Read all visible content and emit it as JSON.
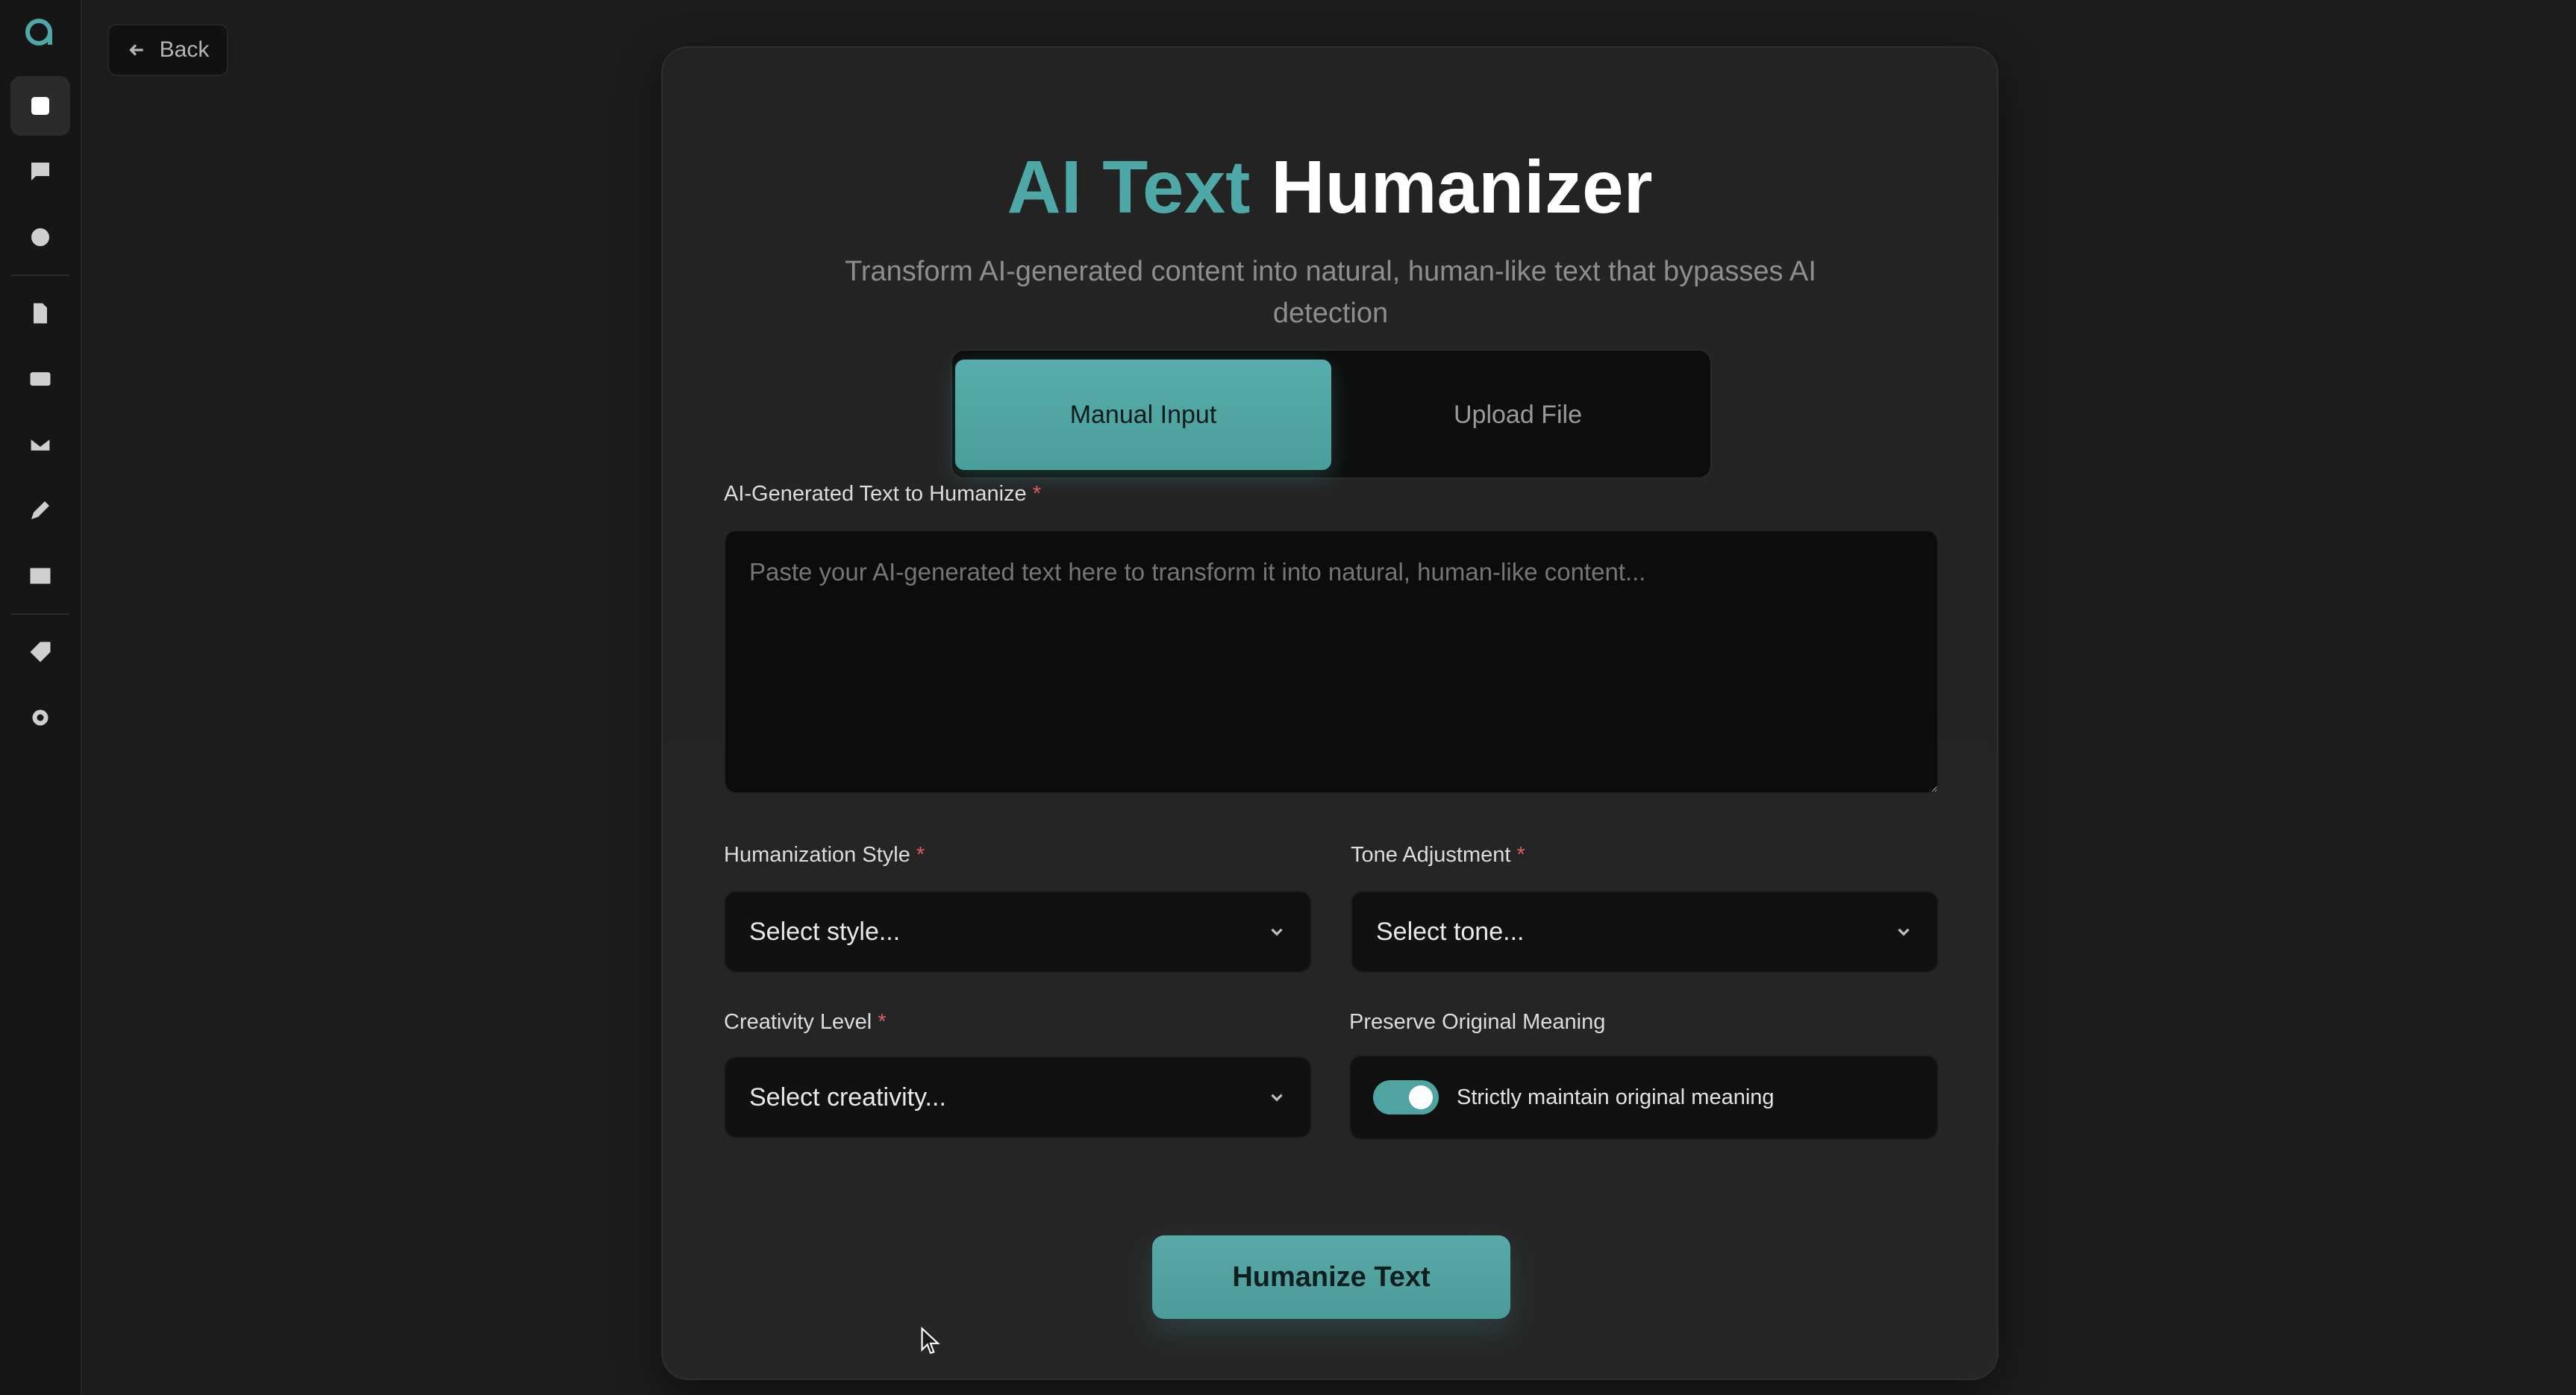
{
  "back_label": "Back",
  "header": {
    "title_accent": "AI Text",
    "title_main": "Humanizer",
    "subtitle": "Transform AI-generated content into natural, human-like text that bypasses AI detection"
  },
  "tabs": [
    {
      "label": "Manual Input",
      "active": true
    },
    {
      "label": "Upload File",
      "active": false
    }
  ],
  "form": {
    "text_label": "AI-Generated Text to Humanize",
    "text_placeholder": "Paste your AI-generated text here to transform it into natural, human-like content...",
    "style_label": "Humanization Style",
    "style_value": "Select style...",
    "tone_label": "Tone Adjustment",
    "tone_value": "Select tone...",
    "creativity_label": "Creativity Level",
    "creativity_value": "Select creativity...",
    "preserve_label": "Preserve Original Meaning",
    "preserve_toggle_label": "Strictly maintain original meaning",
    "preserve_on": true,
    "required_mark": "*",
    "submit_label": "Humanize Text"
  },
  "sidebar": {
    "icons": [
      "app-logo-icon",
      "grid-icon",
      "chat-icon",
      "circle-icon",
      "document-icon",
      "card-icon",
      "mail-icon",
      "pencil-icon",
      "image-icon",
      "tag-icon",
      "settings-icon"
    ]
  },
  "colors": {
    "accent": "#4fa8a8",
    "background": "#1c1c1c",
    "card": "#242424",
    "required": "#e05b5b"
  }
}
